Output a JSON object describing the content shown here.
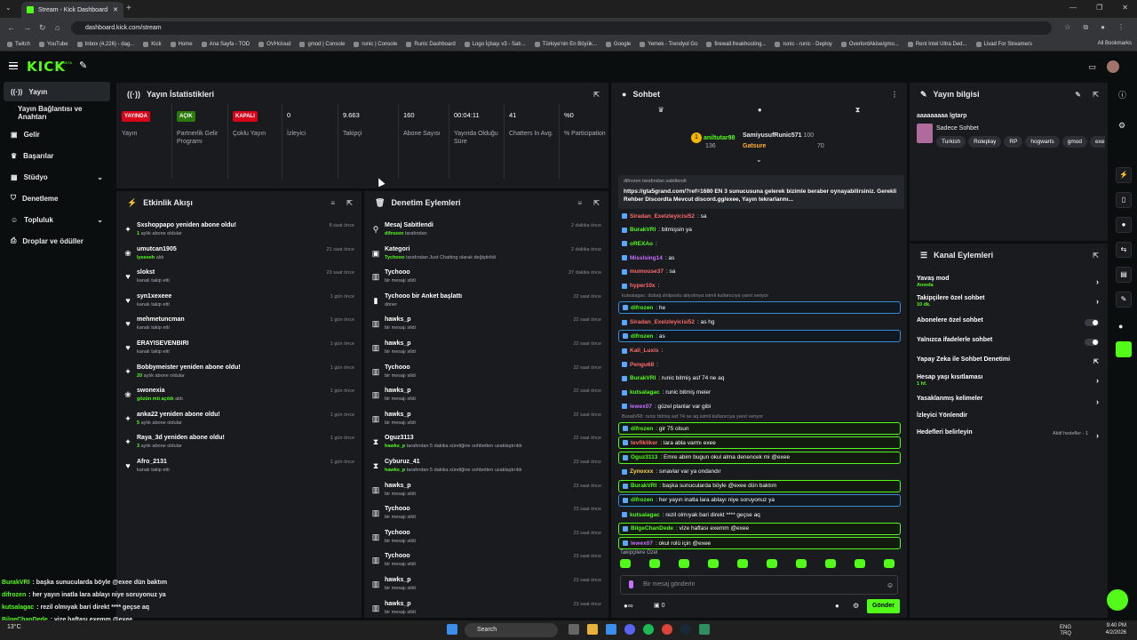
{
  "browser": {
    "tab_title": "Stream - Kick Dashboard",
    "url": "dashboard.kick.com/stream",
    "bookmarks": [
      "Twitch",
      "YouTube",
      "Inbox (4,226) - dag...",
      "Kick",
      "Home",
      "Ana Sayfa - TOD",
      "OVHcloud",
      "gmod | Console",
      "runic | Console",
      "Runic Dashboard",
      "Logo İçbaşı v3 - Satı...",
      "Türkiye'nin En Böyük...",
      "Google",
      "Yemek - Trendyol Go",
      "firewall.freakhosting...",
      "runic - runic - Deploy",
      "OverlordAkise/gmo...",
      "Rent Intel Ultra Ded...",
      "Livad For Streamers"
    ],
    "all_bookmarks": "All Bookmarks"
  },
  "kick": {
    "logo": "KICK",
    "beta": "BETA"
  },
  "sidebar": {
    "items": [
      {
        "label": "Yayın",
        "icon": "broadcast-icon"
      },
      {
        "label": "Yayın Bağlantısı ve Anahtarı"
      },
      {
        "label": "Gelir",
        "icon": "wallet-icon"
      },
      {
        "label": "Başarılar",
        "icon": "trophy-icon"
      },
      {
        "label": "Stüdyo",
        "icon": "studio-icon"
      },
      {
        "label": "Denetleme",
        "icon": "shield-icon"
      },
      {
        "label": "Topluluk",
        "icon": "people-icon"
      },
      {
        "label": "Droplar ve ödüller",
        "icon": "gift-icon"
      }
    ]
  },
  "stats": {
    "title": "Yayın İstatistikleri",
    "items": [
      {
        "value": "YAYINDA",
        "label": "Yayın"
      },
      {
        "value": "AÇIK",
        "label": "Partnerlik Gelir Programı"
      },
      {
        "value": "KAPALI",
        "label": "Çoklu Yayın"
      },
      {
        "value": "0",
        "label": "İzleyici"
      },
      {
        "value": "9.663",
        "label": "Takipçi"
      },
      {
        "value": "160",
        "label": "Abone Sayısı"
      },
      {
        "value": "00:04:11",
        "label": "Yayında Olduğu Süre"
      },
      {
        "value": "41",
        "label": "Chatters In Avg."
      },
      {
        "value": "%0",
        "label": "% Participation"
      }
    ]
  },
  "activity": {
    "title": "Etkinlik Akışı",
    "items": [
      {
        "icon": "star-icon",
        "title": "Sxshoppapo yeniden abone oldu!",
        "sub_hl": "1",
        "sub": " aylık abone oldular",
        "time": "8 saat önce"
      },
      {
        "icon": "gift-icon",
        "title": "umutcan1905",
        "sub_hl": "lyeeeeh",
        "sub": " aldı",
        "time": "21 saat önce"
      },
      {
        "icon": "heart-icon",
        "title": "slokst",
        "sub": "kanalı takip etti",
        "time": "23 saat önce"
      },
      {
        "icon": "heart-icon",
        "title": "syn1xexeee",
        "sub": "kanalı takip etti",
        "time": "1 gün önce"
      },
      {
        "icon": "heart-icon",
        "title": "mehmetuncman",
        "sub": "kanalı takip etti",
        "time": "1 gün önce"
      },
      {
        "icon": "heart-icon",
        "title": "ERAYISEVENBIRI",
        "sub": "kanalı takip etti",
        "time": "1 gün önce"
      },
      {
        "icon": "star-icon",
        "title": "Bobbymeister yeniden abone oldu!",
        "sub_hl": "20",
        "sub": " aylık abone oldular",
        "time": "1 gün önce"
      },
      {
        "icon": "gift-icon",
        "title": "swonexia",
        "sub_hl": "gözün mü açıldı",
        "sub": " aldı",
        "time": "1 gün önce"
      },
      {
        "icon": "star-icon",
        "title": "anka22 yeniden abone oldu!",
        "sub_hl": "5",
        "sub": " aylık abone oldular",
        "time": "1 gün önce"
      },
      {
        "icon": "star-icon",
        "title": "Raya_3d yeniden abone oldu!",
        "sub_hl": "3",
        "sub": " aylık abone oldular",
        "time": "1 gün önce"
      },
      {
        "icon": "heart-icon",
        "title": "Afro_2131",
        "sub": "kanalı takip etti",
        "time": "1 gün önce"
      }
    ]
  },
  "moderation": {
    "title": "Denetim Eylemleri",
    "items": [
      {
        "icon": "pin-icon",
        "title": "Mesaj Sabitlendi",
        "sub_hl": "difrozen",
        "sub": " tarafından",
        "time": "2 dakika önce"
      },
      {
        "icon": "category-icon",
        "title": "Kategori",
        "sub_hl": "Tychooo",
        "sub": " tarafından Just Chatting olarak değiştirildi",
        "time": "2 dakika önce"
      },
      {
        "icon": "trash-icon",
        "title": "Tychooo",
        "sub": "bir mesajı sildi",
        "time": "37 dakika önce"
      },
      {
        "icon": "poll-icon",
        "title": "Tychooo bir Anket başlattı",
        "sub": "döner",
        "time": "22 saat önce"
      },
      {
        "icon": "trash-icon",
        "title": "hawks_p",
        "sub": "bir mesajı sildi",
        "time": "22 saat önce"
      },
      {
        "icon": "trash-icon",
        "title": "hawks_p",
        "sub": "bir mesajı sildi",
        "time": "22 saat önce"
      },
      {
        "icon": "trash-icon",
        "title": "Tychooo",
        "sub": "bir mesajı sildi",
        "time": "22 saat önce"
      },
      {
        "icon": "trash-icon",
        "title": "hawks_p",
        "sub": "bir mesajı sildi",
        "time": "22 saat önce"
      },
      {
        "icon": "trash-icon",
        "title": "hawks_p",
        "sub": "bir mesajı sildi",
        "time": "22 saat önce"
      },
      {
        "icon": "hourglass-icon",
        "title": "Oguz3113",
        "sub_hl": "hawks_p",
        "sub": " tarafından 5 dakika süreliğine sohbetten uzaklaştırıldı",
        "time": "22 saat önce"
      },
      {
        "icon": "hourglass-icon",
        "title": "Cyburuz_41",
        "sub_hl": "hawks_p",
        "sub": " tarafından 5 dakika süreliğine sohbetten uzaklaştırıldı",
        "time": "23 saat önce"
      },
      {
        "icon": "trash-icon",
        "title": "hawks_p",
        "sub": "bir mesajı sildi",
        "time": "23 saat önce"
      },
      {
        "icon": "trash-icon",
        "title": "Tychooo",
        "sub": "bir mesajı sildi",
        "time": "23 saat önce"
      },
      {
        "icon": "trash-icon",
        "title": "Tychooo",
        "sub": "bir mesajı sildi",
        "time": "23 saat önce"
      },
      {
        "icon": "trash-icon",
        "title": "Tychooo",
        "sub": "bir mesajı sildi",
        "time": "23 saat önce"
      },
      {
        "icon": "trash-icon",
        "title": "hawks_p",
        "sub": "bir mesajı sildi",
        "time": "23 saat önce"
      },
      {
        "icon": "trash-icon",
        "title": "hawks_p",
        "sub": "bir mesajı sildi",
        "time": "23 saat önce"
      }
    ]
  },
  "chat": {
    "title": "Sohbet",
    "leaders": [
      {
        "name": "aniltutar98",
        "amount": "136"
      },
      {
        "name": "SamiyusufRunic571",
        "amount": "100"
      },
      {
        "name": "Gatsure",
        "amount": "70"
      }
    ],
    "pinned_by": "difrozen tarafından sabitlendi",
    "pinned_text": "https://gta5grand.com/?ref=1680 EN 3 sunucusuna gelerek bizimle beraber oynayabilirsiniz. Gerekli Rehber Discordta Mevcut discord.gg/exee, Yayın tekrarlarını...",
    "messages": [
      {
        "name": "Siradan_Exelzleyicisi52",
        "color": "#ff6b6b",
        "text": ": sa"
      },
      {
        "name": "BurakVRI",
        "color": "#53fc18",
        "text": ": bitmişsin ya"
      },
      {
        "name": "oREXAo",
        "color": "#53fc18",
        "text": ":"
      },
      {
        "name": "MissIsing14",
        "color": "#c770ff",
        "text": ": as"
      },
      {
        "name": "mumouse37",
        "color": "#ff6b6b",
        "text": ": sa"
      },
      {
        "name": "hyper10x",
        "color": "#ff6b6b",
        "text": ":"
      },
      {
        "name": "difrozen",
        "color": "#53fc18",
        "text": ": he",
        "reply": "kutsalagac: dubaij shitpostu atiyolmya isimli kullanıcıya yanıt veriyor"
      },
      {
        "name": "Siradan_Exelzleyicisi52",
        "color": "#ff6b6b",
        "text": ": as hg"
      },
      {
        "name": "difrozen",
        "color": "#53fc18",
        "text": ": as"
      },
      {
        "name": "Kali_Luxis",
        "color": "#ff6b6b",
        "text": ":"
      },
      {
        "name": "Pengu68",
        "color": "#ff6b6b",
        "text": ":"
      },
      {
        "name": "BurakVRI",
        "color": "#53fc18",
        "text": ": runic bitmiş asf 74 ne aq"
      },
      {
        "name": "kutsalagac",
        "color": "#53fc18",
        "text": ": runic bitmiş meier"
      },
      {
        "name": "lewex07",
        "color": "#c770ff",
        "text": ": güzel planlar var gibi"
      },
      {
        "name": "difrozen",
        "color": "#53fc18",
        "text": ": gir 75 olsun",
        "reply": "BurakVRI: runic bitmiş asf 74 ne aq isimli kullanıcıya yanıt veriyor"
      },
      {
        "name": "tevfikliker",
        "color": "#ff6b6b",
        "text": ": lara abla varmı exee"
      },
      {
        "name": "Oguz3113",
        "color": "#53fc18",
        "text": ": Emre abim bugun okul alma denencek mi @exee"
      },
      {
        "name": "Zynoxxx",
        "color": "#ffd54d",
        "text": ": sınavlar var ya ondandır"
      },
      {
        "name": "BurakVRI",
        "color": "#53fc18",
        "text": ": başka sunucularda böyle @exee dün baktım"
      },
      {
        "name": "difrozen",
        "color": "#53fc18",
        "text": ": her yayın inatla lara ablayı niye soruyonuz ya"
      },
      {
        "name": "kutsalagac",
        "color": "#53fc18",
        "text": ": rezil olmıyak bari direkt **** geçse aq"
      },
      {
        "name": "BilgeChanDede",
        "color": "#53fc18",
        "text": ": vize haftası exemm @exee"
      },
      {
        "name": "lewex07",
        "color": "#c770ff",
        "text": ": okul rolü için @exee"
      }
    ],
    "followers_only": "Takipçilere Özel",
    "placeholder": "Bir mesaj gönderin",
    "send": "Gönder",
    "bottom_count": "0"
  },
  "stream_info": {
    "title": "Yayın bilgisi",
    "stream_title": "aaaaaaaaa lgtarp",
    "category": "Sadece Sohbet",
    "tags": [
      "Turkish",
      "Roleplay",
      "RP",
      "hogwarts",
      "gmod",
      "exe"
    ]
  },
  "channel_actions": {
    "title": "Kanal Eylemleri",
    "items": [
      {
        "label": "Yavaş mod",
        "sub": "Anında",
        "kind": "arrow"
      },
      {
        "label": "Takipçilere özel sohbet",
        "sub": "10 dk.",
        "kind": "arrow"
      },
      {
        "label": "Abonelere özel sohbet",
        "kind": "toggle"
      },
      {
        "label": "Yalnızca ifadelerle sohbet",
        "kind": "toggle"
      },
      {
        "label": "Yapay Zeka ile Sohbet Denetimi",
        "kind": "external"
      },
      {
        "label": "Hesap yaşı kısıtlaması",
        "sub": "1 hf.",
        "kind": "arrow"
      },
      {
        "label": "Yasaklanmış kelimeler",
        "kind": "arrow"
      },
      {
        "label": "İzleyici Yönlendir",
        "kind": "none"
      },
      {
        "label": "Hedefleri belirleyin",
        "extra": "Aktif hedefler - 1",
        "kind": "arrow"
      }
    ]
  },
  "overlay_chat": [
    {
      "name": "BurakVRI",
      "text": ": başka sunucularda böyle @exee dün baktım"
    },
    {
      "name": "difrozen",
      "text": ": her yayın inatla lara ablayı niye soruyonuz ya"
    },
    {
      "name": "kutsalagac",
      "text": ": rezil olmıyak bari direkt **** geçse aq"
    },
    {
      "name": "BilgeChanDede",
      "text": ": vize haftası exemm @exee"
    },
    {
      "name": "lewex07",
      "text": ": okul rolü için @exee"
    }
  ],
  "taskbar": {
    "search": "Search",
    "lang": "ENG",
    "layout": "TRQ",
    "time": "9:40 PM",
    "date": "4/2/2026",
    "weather": "13°C"
  },
  "colors": {
    "accent": "#53fc18",
    "live": "#d6041a",
    "panel": "#191b1f"
  }
}
